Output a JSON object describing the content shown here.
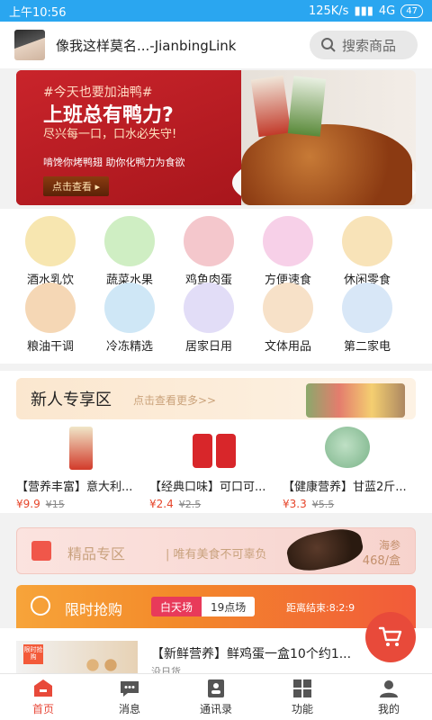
{
  "status": {
    "time": "上午10:56",
    "speed": "125K/s",
    "network": "4G",
    "battery": "47"
  },
  "header": {
    "username": "像我这样莫名...-JianbingLink",
    "search_placeholder": "搜索商品"
  },
  "banner": {
    "tag": "#今天也要加油鸭#",
    "title": "上班总有鸭力?",
    "subtitle": "尽兴每一口，口水必失守!",
    "desc": "啃馋你烤鸭翅 助你化鸭力为食欲",
    "button": "点击查看"
  },
  "categories": [
    {
      "label": "酒水乳饮",
      "color": "#f7e6b0"
    },
    {
      "label": "蔬菜水果",
      "color": "#cfeec3"
    },
    {
      "label": "鸡鱼肉蛋",
      "color": "#f4c7cc"
    },
    {
      "label": "方便速食",
      "color": "#f7d0e8"
    },
    {
      "label": "休闲零食",
      "color": "#f8e3b8"
    },
    {
      "label": "粮油干调",
      "color": "#f5d7b5"
    },
    {
      "label": "冷冻精选",
      "color": "#cfe7f6"
    },
    {
      "label": "居家日用",
      "color": "#e2ddf7"
    },
    {
      "label": "文体用品",
      "color": "#f7e1c8"
    },
    {
      "label": "第二家电",
      "color": "#d8e7f7"
    }
  ],
  "newbie": {
    "title": "新人专享区",
    "more": "点击查看更多>>",
    "products": [
      {
        "name": "【营养丰富】意大利...",
        "price": "¥9.9",
        "old": "¥15"
      },
      {
        "name": "【经典口味】可口可...",
        "price": "¥2.4",
        "old": "¥2.5"
      },
      {
        "name": "【健康营养】甘蓝2斤...",
        "price": "¥3.3",
        "old": "¥5.5"
      }
    ]
  },
  "premium": {
    "title": "精品专区",
    "sub": "唯有美食不可辜负",
    "tag1": "海参",
    "tag2": "468/盒"
  },
  "flash": {
    "title": "限时抢购",
    "seg_a": "白天场",
    "seg_b": "19点场",
    "countdown": "距离结束:8:2:9",
    "item_badge": "限时抢购",
    "item_title": "【新鲜营养】鲜鸡蛋一盒10个约1...",
    "restock": "没日货"
  },
  "tabs": [
    {
      "label": "首页",
      "icon": "home-icon",
      "active": true
    },
    {
      "label": "消息",
      "icon": "message-icon",
      "active": false
    },
    {
      "label": "通讯录",
      "icon": "contacts-icon",
      "active": false
    },
    {
      "label": "功能",
      "icon": "grid-icon",
      "active": false
    },
    {
      "label": "我的",
      "icon": "profile-icon",
      "active": false
    }
  ],
  "colors": {
    "status_bar": "#2aa6f0",
    "accent": "#e84a3a",
    "price": "#e6452a"
  }
}
